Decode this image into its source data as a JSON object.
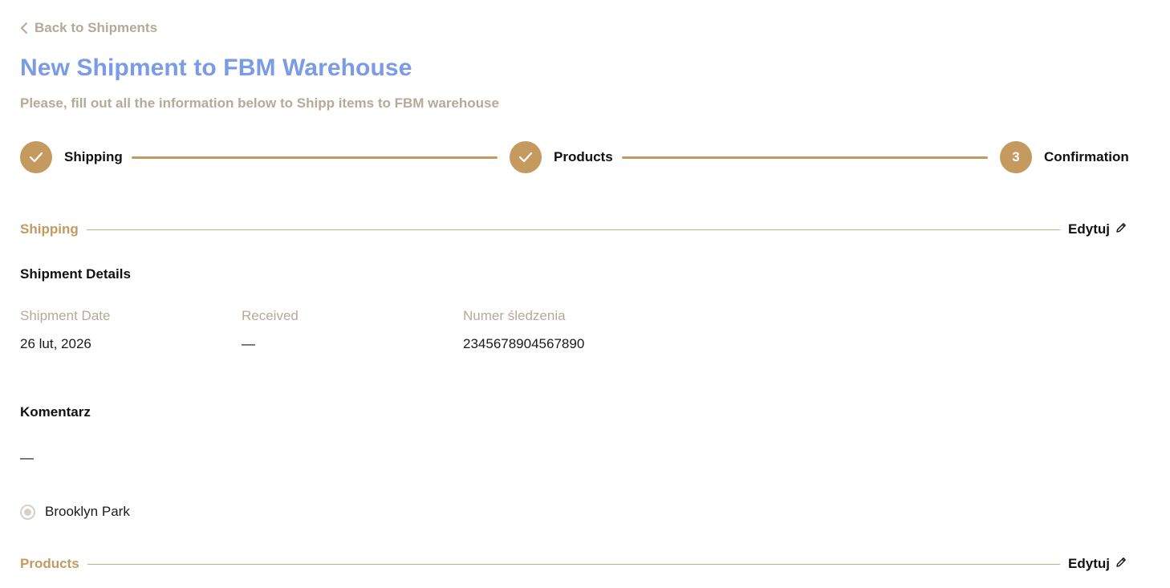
{
  "back_link": {
    "label": "Back to Shipments",
    "icon": "chevron-left-icon"
  },
  "header": {
    "title": "New Shipment to FBM Warehouse",
    "subtitle": "Please, fill out all the information below to Shipp items to FBM warehouse"
  },
  "stepper": {
    "steps": [
      {
        "label": "Shipping",
        "state": "completed",
        "icon": "check-icon"
      },
      {
        "label": "Products",
        "state": "completed",
        "icon": "check-icon"
      },
      {
        "label": "Confirmation",
        "state": "current",
        "number": "3"
      }
    ]
  },
  "shipping_section": {
    "title": "Shipping",
    "edit_label": "Edytuj",
    "details_heading": "Shipment Details",
    "fields": [
      {
        "label": "Shipment Date",
        "value": "26 lut, 2026"
      },
      {
        "label": "Received",
        "value": "—"
      },
      {
        "label": "Numer śledzenia",
        "value": "2345678904567890"
      }
    ],
    "comment_heading": "Komentarz",
    "comment_value": "—",
    "warehouse_option": {
      "label": "Brooklyn Park",
      "selected": true
    }
  },
  "products_section": {
    "title": "Products",
    "edit_label": "Edytuj"
  },
  "colors": {
    "accent_gold": "#c49a5e",
    "title_blue": "#7b9be6",
    "muted_text": "#b7a99a"
  }
}
